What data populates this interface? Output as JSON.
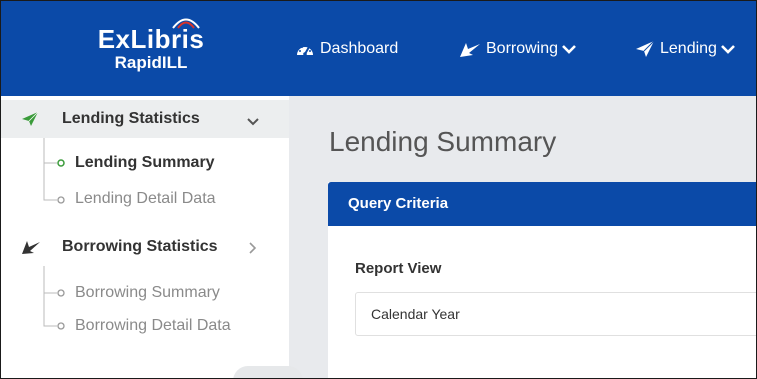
{
  "header": {
    "logo": {
      "line1": "ExLibris",
      "line2": "RapidILL"
    },
    "nav": [
      {
        "label": "Dashboard",
        "icon": "dashboard-icon"
      },
      {
        "label": "Borrowing",
        "icon": "borrowing-arrow-icon"
      },
      {
        "label": "Lending",
        "icon": "lending-plane-icon"
      }
    ]
  },
  "sidebar": {
    "groups": [
      {
        "label": "Lending Statistics",
        "icon": "lending-plane-icon",
        "expanded": true,
        "items": [
          "Lending Summary",
          "Lending Detail Data"
        ],
        "selected": "Lending Summary"
      },
      {
        "label": "Borrowing Statistics",
        "icon": "borrowing-arrow-icon",
        "expanded": false,
        "items": [
          "Borrowing Summary",
          "Borrowing Detail Data"
        ]
      }
    ]
  },
  "main": {
    "title": "Lending Summary",
    "card": {
      "title": "Query Criteria",
      "field_label": "Report View",
      "select_value": "Calendar Year"
    }
  },
  "colors": {
    "header_blue": "#0b4aa8",
    "accent_green": "#3a9b3a",
    "main_bg": "#e8eaed"
  }
}
